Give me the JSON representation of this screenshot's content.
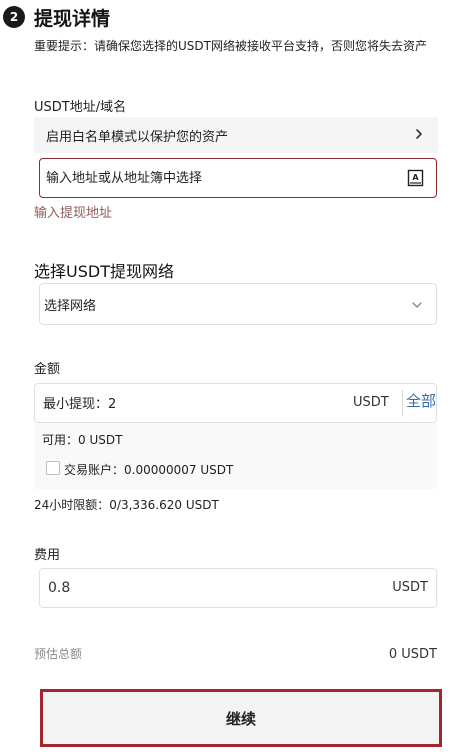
{
  "step": {
    "number": "2",
    "title": "提现详情"
  },
  "notice": "重要提示：请确保您选择的USDT网络被接收平台支持，否则您将失去资产",
  "address": {
    "label": "USDT地址/域名",
    "whitelist_text": "启用白名单模式以保护您的资产",
    "placeholder": "输入地址或从地址簿中选择",
    "error_hint": "输入提现地址"
  },
  "network": {
    "title": "选择USDT提现网络",
    "placeholder": "选择网络"
  },
  "amount": {
    "label": "金额",
    "placeholder": "最小提现：2",
    "unit": "USDT",
    "all_label": "全部",
    "available": "可用：0 USDT",
    "trading_account": "交易账户：0.00000007 USDT",
    "daily_limit": "24小时限额：0/3,336.620 USDT"
  },
  "fee": {
    "label": "费用",
    "value": "0.8",
    "unit": "USDT"
  },
  "estimate": {
    "label": "预估总额",
    "value": "0 USDT"
  },
  "continue_label": "继续",
  "colors": {
    "error_border": "#8a2c2c",
    "button_border": "#a3262e",
    "link_blue": "#3a6ea5"
  }
}
